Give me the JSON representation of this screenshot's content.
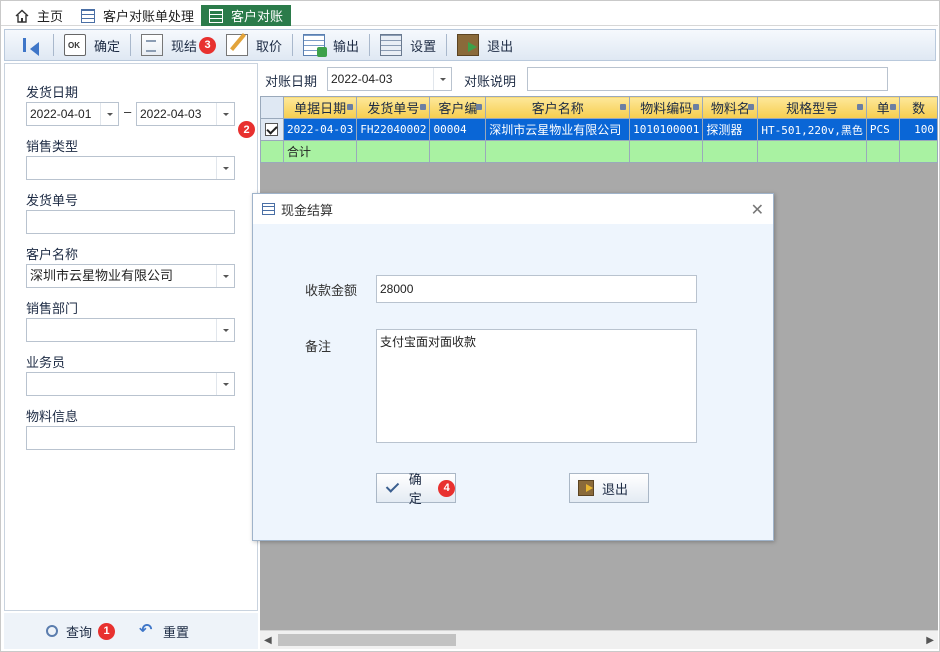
{
  "tabs": [
    {
      "label": "主页"
    },
    {
      "label": "客户对账单处理"
    },
    {
      "label": "客户对账"
    }
  ],
  "toolbar": {
    "confirm": "确定",
    "settle": "现结",
    "settle_badge": "3",
    "fetch_price": "取价",
    "export": "输出",
    "settings": "设置",
    "exit": "退出"
  },
  "filters": {
    "ship_date_label": "发货日期",
    "ship_date_from": "2022-04-01",
    "range_sep": "–",
    "ship_date_to": "2022-04-03",
    "sales_type_label": "销售类型",
    "sales_type_value": "",
    "ship_no_label": "发货单号",
    "ship_no_value": "",
    "customer_label": "客户名称",
    "customer_value": "深圳市云星物业有限公司",
    "dept_label": "销售部门",
    "dept_value": "",
    "salesman_label": "业务员",
    "salesman_value": "",
    "material_label": "物料信息",
    "material_value": "",
    "query": "查询",
    "query_badge": "1",
    "reset": "重置"
  },
  "header": {
    "recon_date_label": "对账日期",
    "recon_date_value": "2022-04-03",
    "recon_note_label": "对账说明",
    "recon_note_value": ""
  },
  "grid": {
    "columns": [
      "单据日期",
      "发货单号",
      "客户编",
      "客户名称",
      "物料编码",
      "物料名",
      "规格型号",
      "单",
      "数"
    ],
    "rows": [
      [
        "2022-04-03",
        "FH22040002",
        "00004",
        "深圳市云星物业有限公司",
        "1010100001",
        "探测器",
        "HT-501,220v,黑色",
        "PCS",
        "100"
      ]
    ],
    "row_badge": "2",
    "summary_label": "合计"
  },
  "dialog": {
    "title": "现金结算",
    "amount_label": "收款金额",
    "amount_value": "28000",
    "note_label": "备注",
    "note_value": "支付宝面对面收款",
    "ok": "确定",
    "ok_badge": "4",
    "exit": "退出"
  },
  "colors": {
    "active_tab": "#2b7b4a",
    "selected_row": "#0a66d6",
    "summary_row": "#a9f2a2",
    "header_gold": "#f6cd4e",
    "badge_red": "#e8312f"
  }
}
